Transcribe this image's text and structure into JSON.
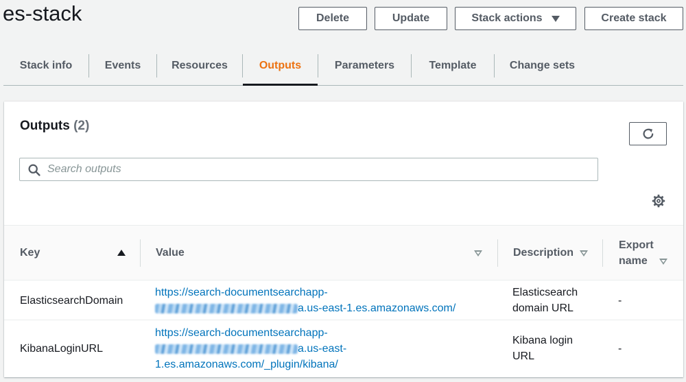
{
  "header": {
    "title": "es-stack",
    "buttons": {
      "delete": "Delete",
      "update": "Update",
      "stack_actions": "Stack actions",
      "create_stack": "Create stack"
    }
  },
  "tabs": [
    {
      "label": "Stack info",
      "active": false
    },
    {
      "label": "Events",
      "active": false
    },
    {
      "label": "Resources",
      "active": false
    },
    {
      "label": "Outputs",
      "active": true
    },
    {
      "label": "Parameters",
      "active": false
    },
    {
      "label": "Template",
      "active": false
    },
    {
      "label": "Change sets",
      "active": false
    }
  ],
  "outputs": {
    "title": "Outputs",
    "count": "(2)",
    "search_placeholder": "Search outputs",
    "columns": {
      "key": "Key",
      "value": "Value",
      "description": "Description",
      "export_name_line1": "Export",
      "export_name_line2": "name"
    },
    "rows": [
      {
        "key": "ElasticsearchDomain",
        "value_line1": "https://search-documentsearchapp-",
        "value_line2_suffix": "a.us-east-1.es.amazonaws.com/",
        "description_line1": "Elasticsearch",
        "description_line2": "domain URL",
        "export_name": "-"
      },
      {
        "key": "KibanaLoginURL",
        "value_line1": "https://search-documentsearchapp-",
        "value_line2_suffix": "a.us-east-",
        "value_line3": "1.es.amazonaws.com/_plugin/kibana/",
        "description_line1": "Kibana login",
        "description_line2": "URL",
        "export_name": "-"
      }
    ]
  },
  "icons": {
    "search": "search-icon",
    "refresh": "refresh-icon",
    "settings": "gear-icon",
    "dropdown": "caret-down-icon",
    "sort_asc": "sort-ascending-icon",
    "sort_desc": "sort-descending-icon"
  },
  "colors": {
    "accent": "#ec7211",
    "link": "#0073bb",
    "text": "#16191f",
    "secondary": "#545b64"
  }
}
